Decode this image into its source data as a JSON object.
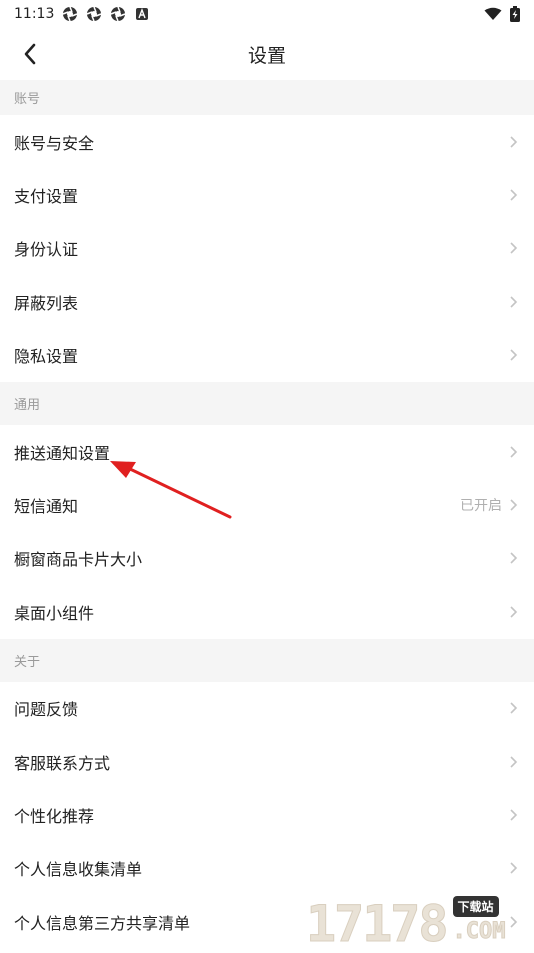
{
  "status_bar": {
    "time": "11:13",
    "left_icons": [
      "aperture-icon",
      "aperture-icon",
      "aperture-icon",
      "a-badge-icon"
    ],
    "right_icons": [
      "wifi-icon",
      "battery-charging-icon"
    ]
  },
  "header": {
    "title": "设置",
    "back_icon": "chevron-left-icon"
  },
  "sections": [
    {
      "label": "账号",
      "items": [
        {
          "label": "账号与安全"
        },
        {
          "label": "支付设置"
        },
        {
          "label": "身份认证"
        },
        {
          "label": "屏蔽列表"
        },
        {
          "label": "隐私设置"
        }
      ]
    },
    {
      "label": "通用",
      "items": [
        {
          "label": "推送通知设置"
        },
        {
          "label": "短信通知",
          "value": "已开启"
        },
        {
          "label": "橱窗商品卡片大小"
        },
        {
          "label": "桌面小组件"
        }
      ]
    },
    {
      "label": "关于",
      "items": [
        {
          "label": "问题反馈"
        },
        {
          "label": "客服联系方式"
        },
        {
          "label": "个性化推荐"
        },
        {
          "label": "个人信息收集清单"
        },
        {
          "label": "个人信息第三方共享清单"
        }
      ]
    }
  ],
  "annotation": {
    "arrow_color": "#e02020"
  },
  "watermark": {
    "number": "17178",
    "badge": "下载站",
    "domain": ".COM"
  }
}
